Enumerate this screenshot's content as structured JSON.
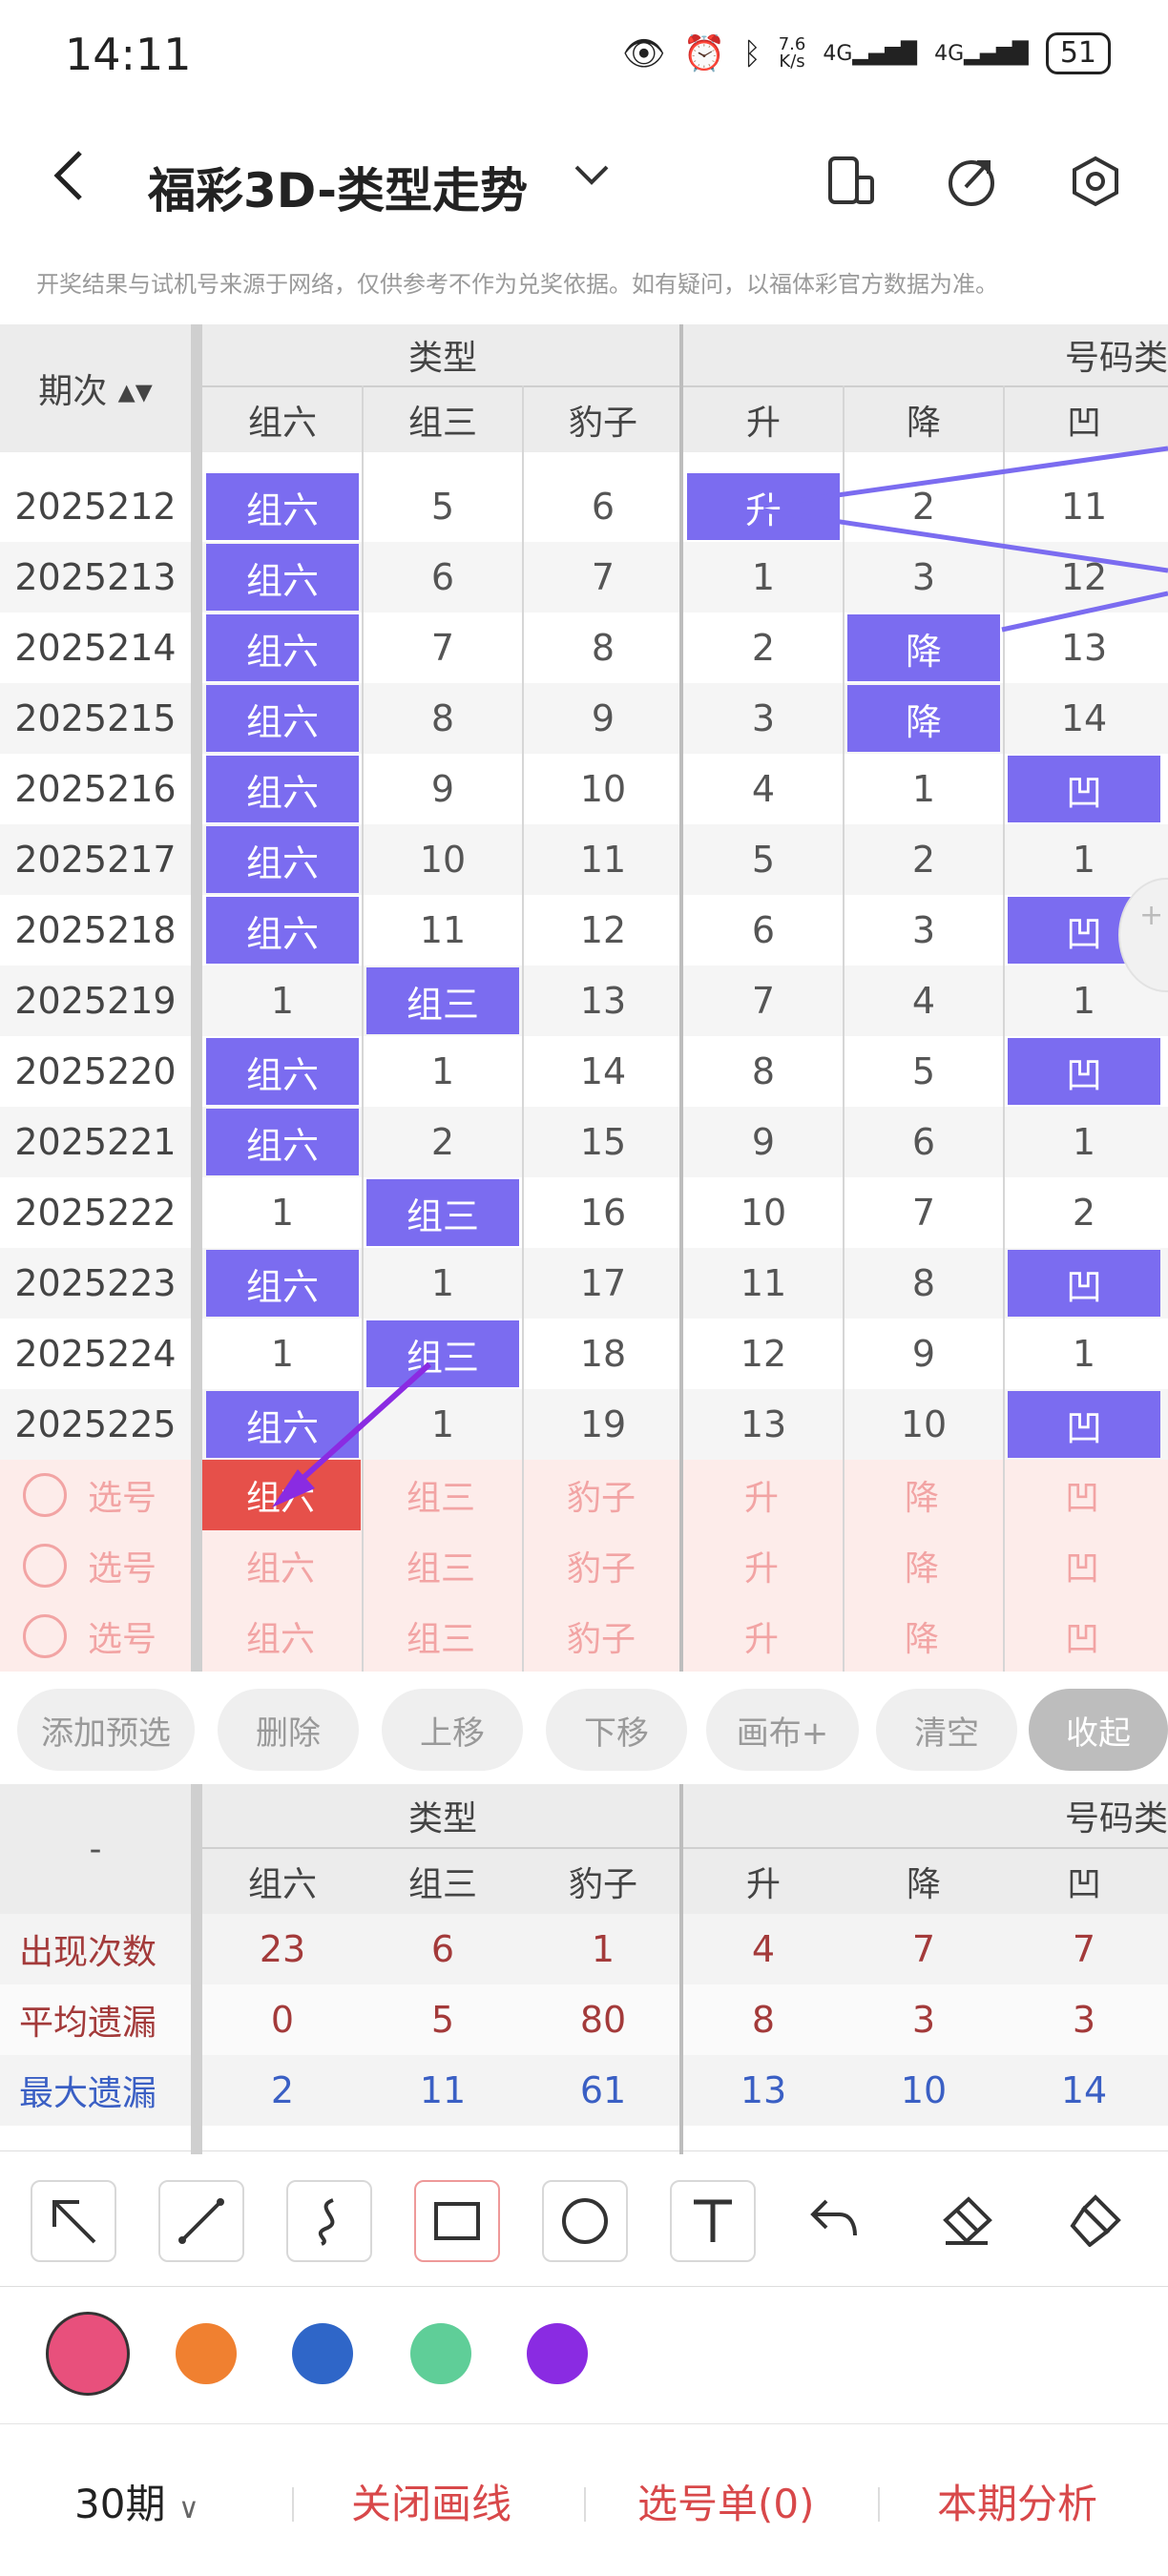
{
  "status": {
    "time": "14:11",
    "net_speed_top": "7.6",
    "net_speed_bottom": "K/s",
    "sig1": "4G",
    "sig2": "4G",
    "battery": "51"
  },
  "header": {
    "title": "福彩3D-类型走势"
  },
  "notice": "开奖结果与试机号来源于网络，仅供参考不作为兑奖依据。如有疑问，以福体彩官方数据为准。",
  "table": {
    "period_header": "期次",
    "group_type": "类型",
    "group_number": "号码类",
    "columns": [
      "组六",
      "组三",
      "豹子",
      "升",
      "降",
      "凹"
    ],
    "rows": [
      {
        "period": "2025212",
        "cells": [
          "组六",
          "5",
          "6",
          "升",
          "2",
          "11"
        ]
      },
      {
        "period": "2025213",
        "cells": [
          "组六",
          "6",
          "7",
          "1",
          "3",
          "12"
        ]
      },
      {
        "period": "2025214",
        "cells": [
          "组六",
          "7",
          "8",
          "2",
          "降",
          "13"
        ]
      },
      {
        "period": "2025215",
        "cells": [
          "组六",
          "8",
          "9",
          "3",
          "降",
          "14"
        ]
      },
      {
        "period": "2025216",
        "cells": [
          "组六",
          "9",
          "10",
          "4",
          "1",
          "凹"
        ]
      },
      {
        "period": "2025217",
        "cells": [
          "组六",
          "10",
          "11",
          "5",
          "2",
          "1"
        ]
      },
      {
        "period": "2025218",
        "cells": [
          "组六",
          "11",
          "12",
          "6",
          "3",
          "凹"
        ]
      },
      {
        "period": "2025219",
        "cells": [
          "1",
          "组三",
          "13",
          "7",
          "4",
          "1"
        ]
      },
      {
        "period": "2025220",
        "cells": [
          "组六",
          "1",
          "14",
          "8",
          "5",
          "凹"
        ]
      },
      {
        "period": "2025221",
        "cells": [
          "组六",
          "2",
          "15",
          "9",
          "6",
          "1"
        ]
      },
      {
        "period": "2025222",
        "cells": [
          "1",
          "组三",
          "16",
          "10",
          "7",
          "2"
        ]
      },
      {
        "period": "2025223",
        "cells": [
          "组六",
          "1",
          "17",
          "11",
          "8",
          "凹"
        ]
      },
      {
        "period": "2025224",
        "cells": [
          "1",
          "组三",
          "18",
          "12",
          "9",
          "1"
        ]
      },
      {
        "period": "2025225",
        "cells": [
          "组六",
          "1",
          "19",
          "13",
          "10",
          "凹"
        ]
      }
    ],
    "prediction_label": "选号",
    "prediction_rows": 3
  },
  "actions": [
    "添加预选",
    "删除",
    "上移",
    "下移",
    "画布+",
    "清空",
    "收起"
  ],
  "stats": {
    "dash": "-",
    "rows": [
      {
        "label": "出现次数",
        "values": [
          "23",
          "6",
          "1",
          "4",
          "7",
          "7"
        ],
        "color": "#a33a3a"
      },
      {
        "label": "平均遗漏",
        "values": [
          "0",
          "5",
          "80",
          "8",
          "3",
          "3"
        ],
        "color": "#a33a3a"
      },
      {
        "label": "最大遗漏",
        "values": [
          "2",
          "11",
          "61",
          "13",
          "10",
          "14"
        ],
        "color": "#3a5fc4"
      }
    ]
  },
  "palette": [
    "#e8507c",
    "#f08030",
    "#2f66c8",
    "#5fce98",
    "#8a2be2"
  ],
  "bottom": {
    "periods": "30期",
    "close_draw": "关闭画线",
    "selection": "选号单(0)",
    "analysis": "本期分析"
  }
}
